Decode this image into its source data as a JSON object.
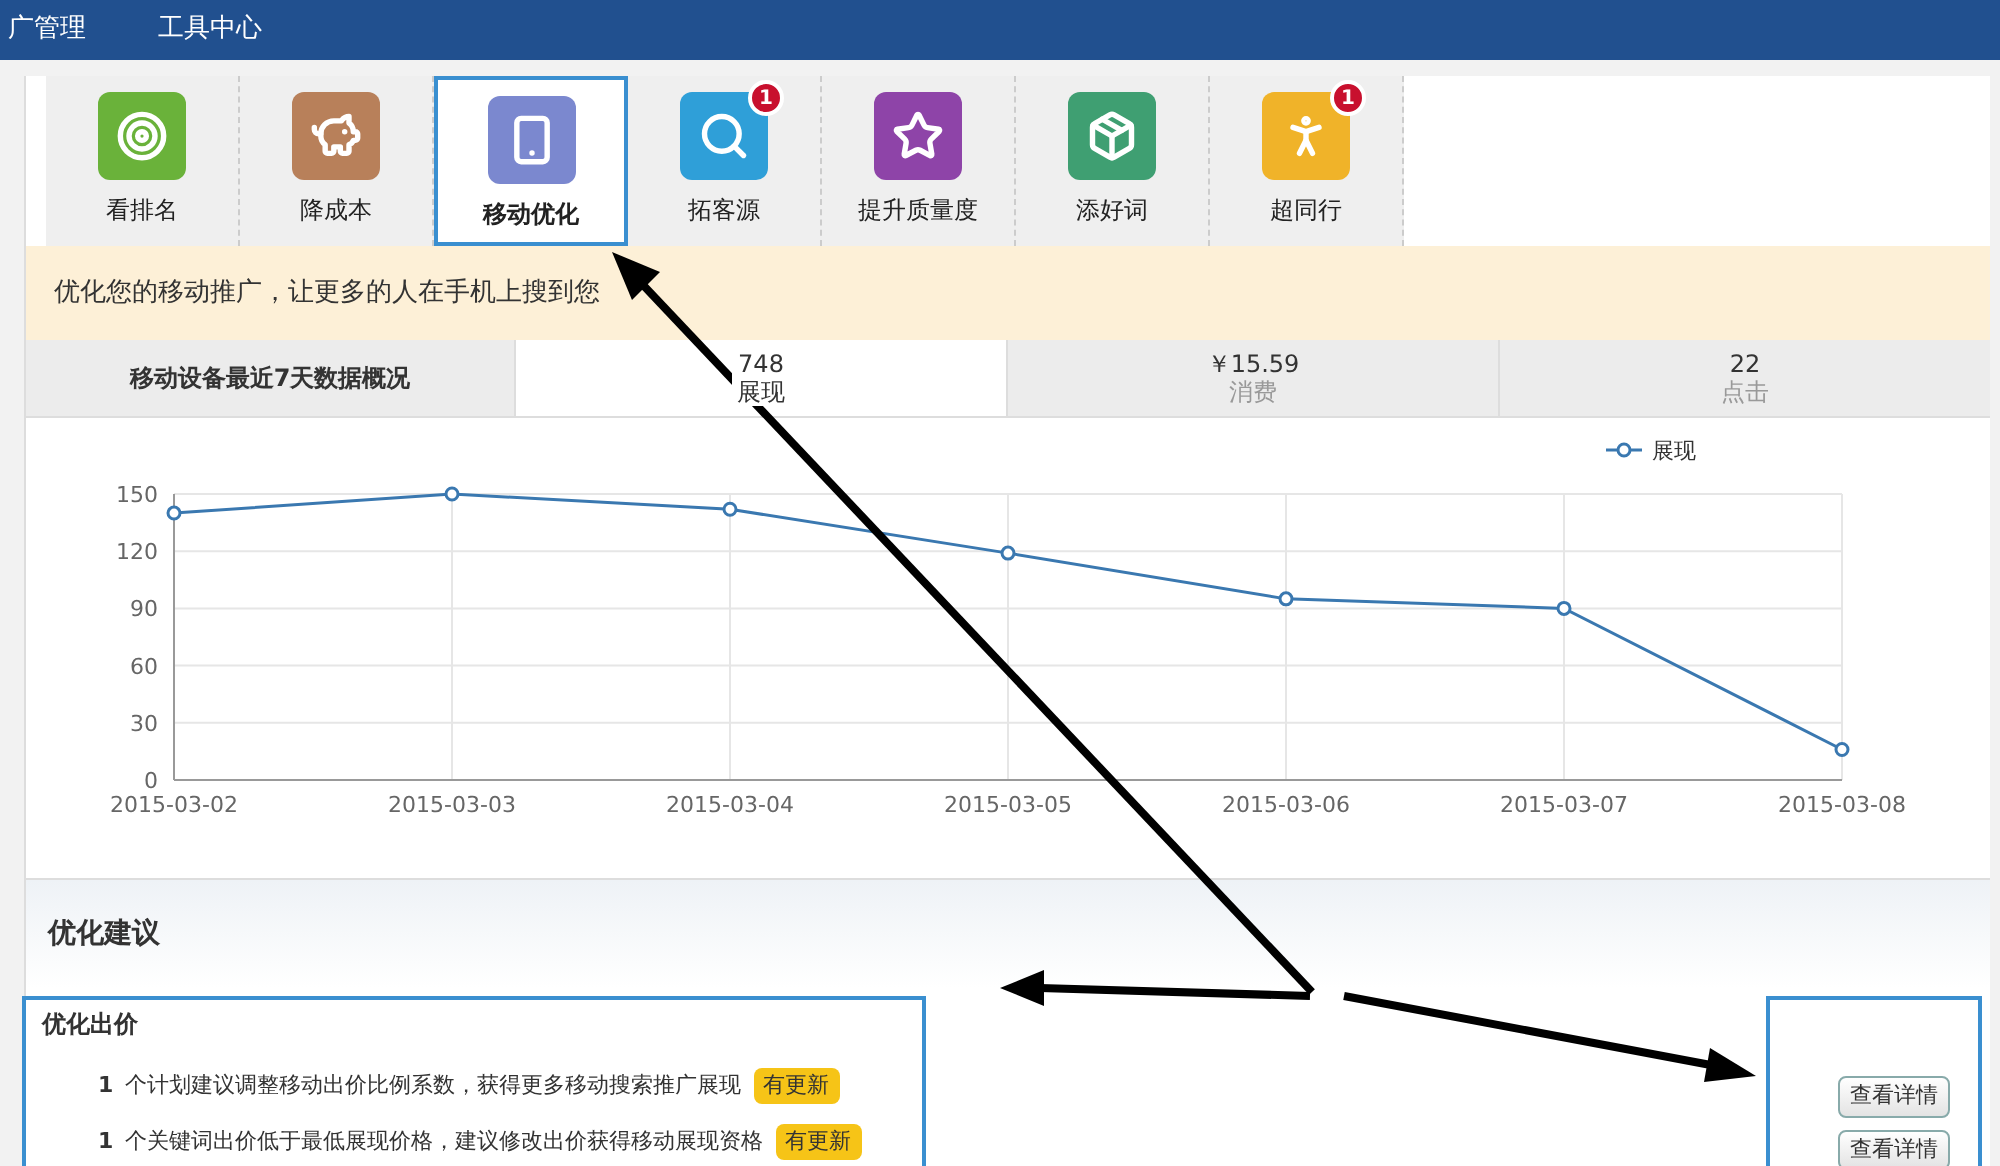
{
  "top_nav": [
    "广管理",
    "工具中心"
  ],
  "tabs": [
    {
      "label": "看排名",
      "color": "#6ab23a",
      "selected": false
    },
    {
      "label": "降成本",
      "color": "#b8805a",
      "selected": false
    },
    {
      "label": "移动优化",
      "color": "#7b88cf",
      "selected": true
    },
    {
      "label": "拓客源",
      "color": "#2f9fd8",
      "selected": false,
      "badge": "1"
    },
    {
      "label": "提升质量度",
      "color": "#8e44a8",
      "selected": false
    },
    {
      "label": "添好词",
      "color": "#3f9f72",
      "selected": false
    },
    {
      "label": "超同行",
      "color": "#f0b329",
      "selected": false,
      "badge": "1"
    }
  ],
  "banner": "优化您的移动推广，让更多的人在手机上搜到您",
  "stats": {
    "title": "移动设备最近7天数据概况",
    "items": [
      {
        "value": "748",
        "label": "展现",
        "selected": true
      },
      {
        "value": "￥15.59",
        "label": "消费",
        "selected": false
      },
      {
        "value": "22",
        "label": "点击",
        "selected": false
      }
    ]
  },
  "chart_data": {
    "type": "line",
    "categories": [
      "2015-03-02",
      "2015-03-03",
      "2015-03-04",
      "2015-03-05",
      "2015-03-06",
      "2015-03-07",
      "2015-03-08"
    ],
    "series": [
      {
        "name": "展现",
        "color": "#3a78b0",
        "marker": "circle",
        "values": [
          140,
          150,
          142,
          119,
          95,
          90,
          16
        ]
      }
    ],
    "grid": true,
    "ylim": [
      0,
      150
    ],
    "yticks": [
      0,
      30,
      60,
      90,
      120,
      150
    ]
  },
  "suggestions": {
    "title": "优化建议",
    "group_title": "优化出价",
    "rows": [
      {
        "count": "1",
        "text": "个计划建议调整移动出价比例系数，获得更多移动搜索推广展现",
        "badge": "有更新",
        "button": "查看详情"
      },
      {
        "count": "1",
        "text": "个关键词出价低于最低展现价格，建议修改出价获得移动展现资格",
        "badge": "有更新",
        "button": "查看详情"
      }
    ]
  }
}
